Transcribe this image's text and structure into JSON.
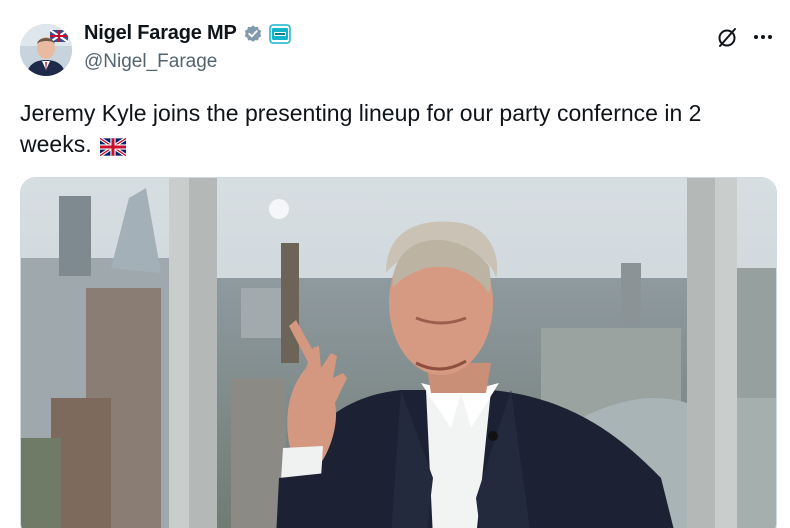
{
  "author": {
    "display_name": "Nigel Farage MP",
    "handle": "@Nigel_Farage",
    "verified": true,
    "avatar_icon": "avatar-photo",
    "affiliate_badge_icon": "affiliate-badge-icon"
  },
  "header_actions": {
    "grok_icon": "grok-icon",
    "more_icon": "more-options-icon"
  },
  "tweet": {
    "text": "Jeremy Kyle joins the presenting lineup for our party confernce in 2 weeks.",
    "emoji": "🇬🇧"
  },
  "media": {
    "type": "photo"
  },
  "colors": {
    "text_primary": "#0f1419",
    "text_secondary": "#536471",
    "verified_badge": "#829aab",
    "border": "#cfd9de"
  }
}
